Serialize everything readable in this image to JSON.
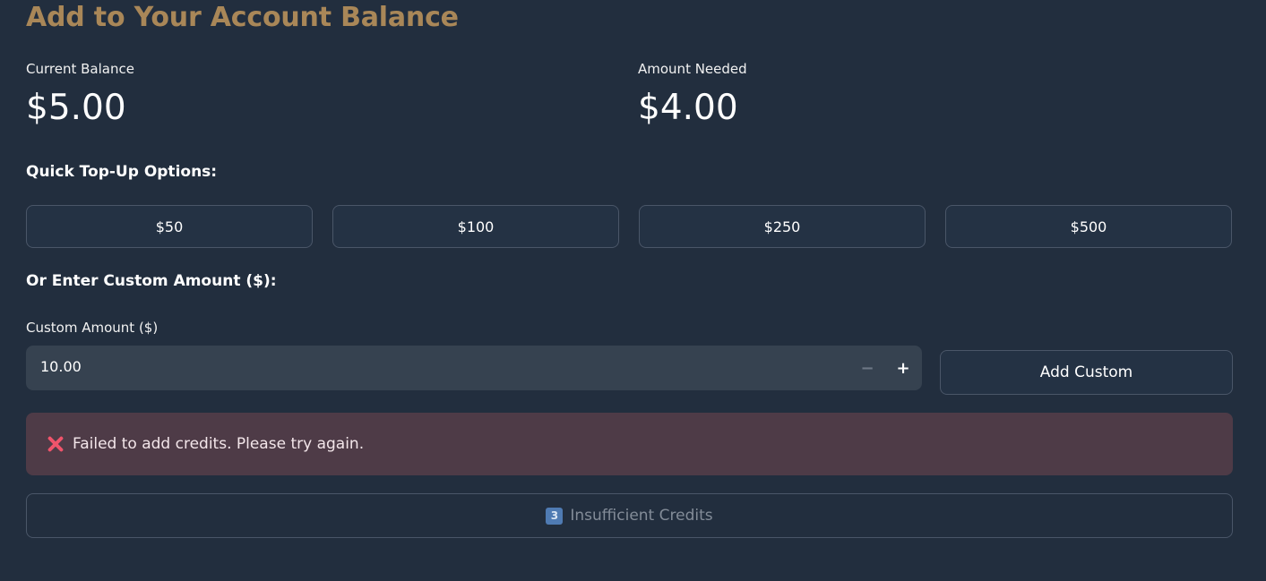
{
  "page": {
    "title": "Add to Your Account Balance"
  },
  "metrics": {
    "current_balance": {
      "label": "Current Balance",
      "value": "$5.00"
    },
    "amount_needed": {
      "label": "Amount Needed",
      "value": "$4.00"
    }
  },
  "quick_topup": {
    "heading": "Quick Top-Up Options:",
    "options": [
      "$50",
      "$100",
      "$250",
      "$500"
    ]
  },
  "custom": {
    "heading": "Or Enter Custom Amount ($):",
    "field_label": "Custom Amount ($)",
    "value": "10.00",
    "decrement_symbol": "−",
    "increment_symbol": "+",
    "button_label": "Add Custom"
  },
  "alert": {
    "icon": "cross-mark-icon",
    "message": "Failed to add credits. Please try again.",
    "color": "#f0546b"
  },
  "status_button": {
    "icon": "keycap-3-icon",
    "icon_text": "3",
    "label": "Insufficient Credits"
  },
  "colors": {
    "background": "#222e3e",
    "title": "#a98758",
    "alert_background": "#4e3b47"
  }
}
